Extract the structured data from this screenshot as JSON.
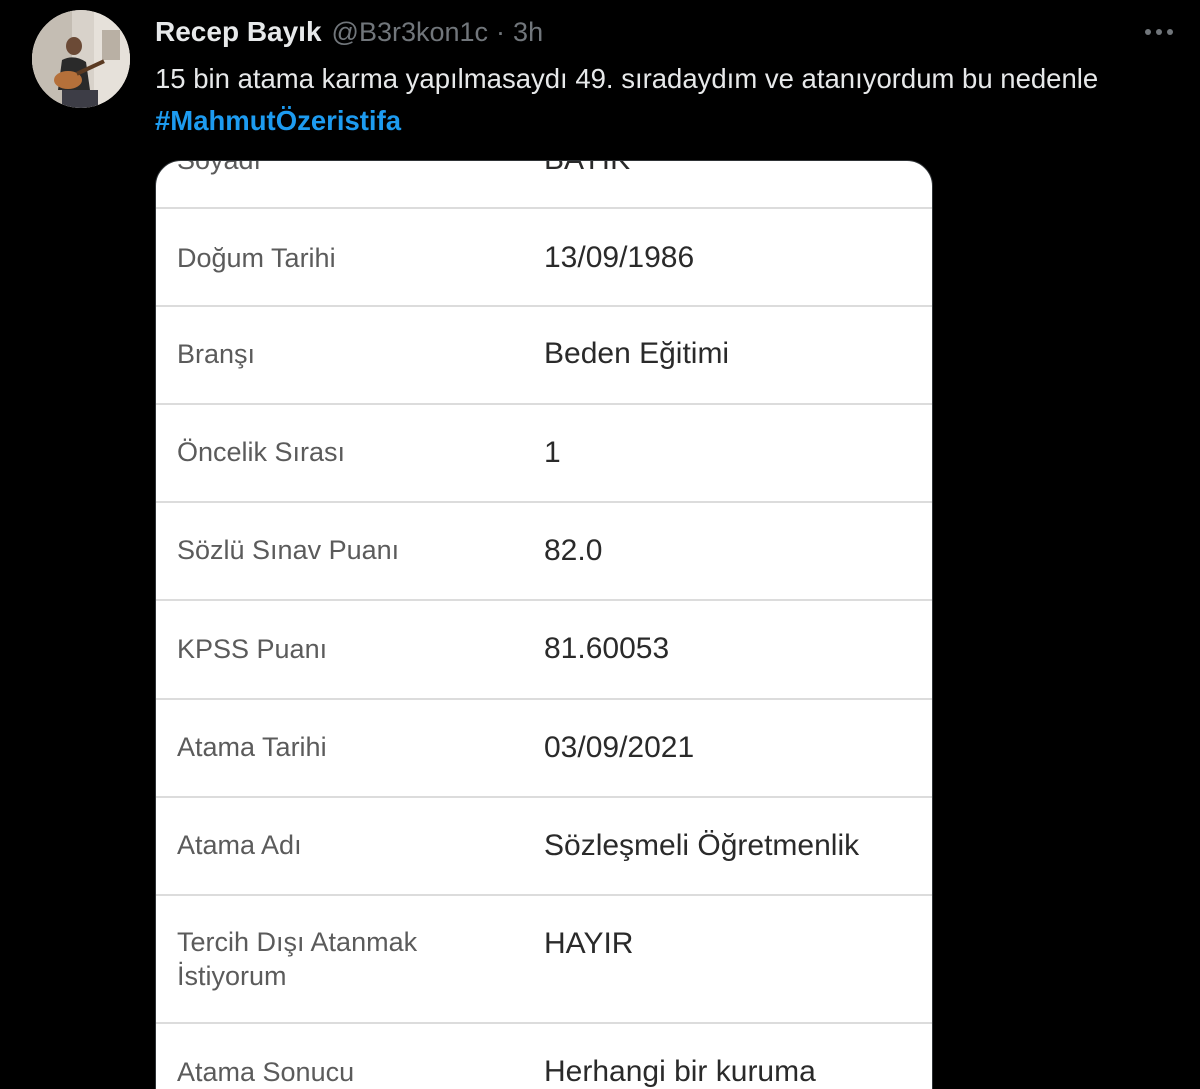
{
  "tweet": {
    "author_name": "Recep Bayık",
    "handle": "@B3r3kon1c",
    "separator": "·",
    "time": "3h",
    "text_before": "15 bin atama karma yapılmasaydı 49. sıradaydım ve atanıyordum bu nedenle ",
    "hashtag": "#MahmutÖzeristifa",
    "more_icon": "more-horizontal-icon"
  },
  "colors": {
    "background": "#000000",
    "name": "#e7e9ea",
    "muted": "#71767b",
    "link": "#1d9bf0"
  },
  "media": {
    "rows": [
      {
        "label": "Soyadı",
        "value": "BAYIK"
      },
      {
        "label": "Doğum Tarihi",
        "value": "13/09/1986"
      },
      {
        "label": "Branşı",
        "value": "Beden Eğitimi"
      },
      {
        "label": "Öncelik Sırası",
        "value": "1"
      },
      {
        "label": "Sözlü Sınav Puanı",
        "value": "82.0"
      },
      {
        "label": "KPSS Puanı",
        "value": "81.60053"
      },
      {
        "label": "Atama Tarihi",
        "value": "03/09/2021"
      },
      {
        "label": "Atama Adı",
        "value": "Sözleşmeli Öğretmenlik"
      },
      {
        "label": "Tercih Dışı Atanmak İstiyorum",
        "value": "HAYIR"
      },
      {
        "label": "Atama Sonucu",
        "value": "Herhangi bir kuruma"
      }
    ]
  }
}
